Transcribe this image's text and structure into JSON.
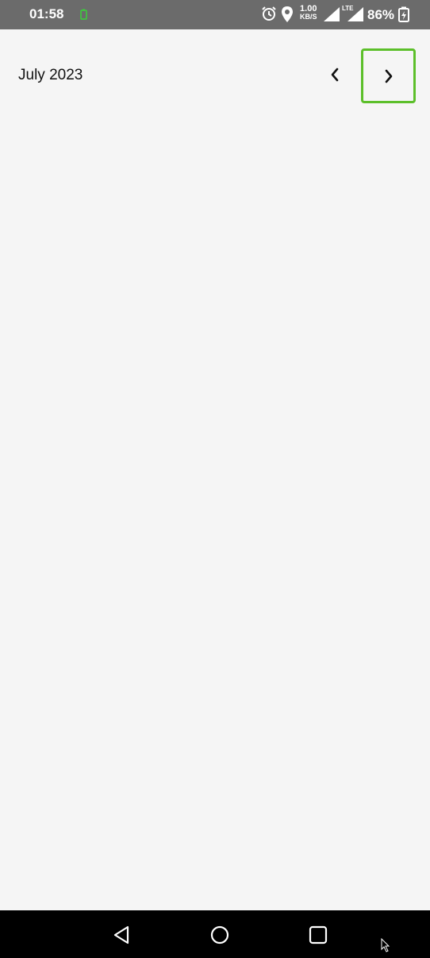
{
  "status_bar": {
    "time": "01:58",
    "speed_value": "1.00",
    "speed_unit": "KB/S",
    "network_type": "LTE",
    "battery_percent": "86%"
  },
  "header": {
    "month_label": "July 2023"
  },
  "icons": {
    "prev": "chevron-left-icon",
    "next": "chevron-right-icon",
    "back": "nav-back-icon",
    "home": "nav-home-icon",
    "recent": "nav-recent-icon"
  },
  "colors": {
    "highlight": "#5cbf2a",
    "status_bar": "#6b6b6b",
    "nav_bar": "#000000",
    "background": "#f5f5f5"
  }
}
